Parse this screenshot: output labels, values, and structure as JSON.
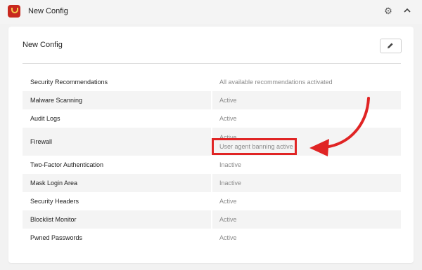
{
  "app": {
    "title": "New Config"
  },
  "card": {
    "title": "New Config"
  },
  "rows": [
    {
      "label": "Security Recommendations",
      "value": "All available recommendations activated"
    },
    {
      "label": "Malware Scanning",
      "value": "Active"
    },
    {
      "label": "Audit Logs",
      "value": "Active"
    },
    {
      "label": "Firewall",
      "value": "Active",
      "sub_value": "User agent banning active"
    },
    {
      "label": "Two-Factor Authentication",
      "value": "Inactive"
    },
    {
      "label": "Mask Login Area",
      "value": "Inactive"
    },
    {
      "label": "Security Headers",
      "value": "Active"
    },
    {
      "label": "Blocklist Monitor",
      "value": "Active"
    },
    {
      "label": "Pwned Passwords",
      "value": "Active"
    }
  ],
  "colors": {
    "annotation": "#e02424",
    "brand": "#c8281e",
    "accent": "#f3c94c"
  },
  "icons": {
    "app": "app-logo-icon",
    "settings": "gear-icon",
    "collapse": "chevron-up-icon",
    "edit": "pencil-icon"
  }
}
